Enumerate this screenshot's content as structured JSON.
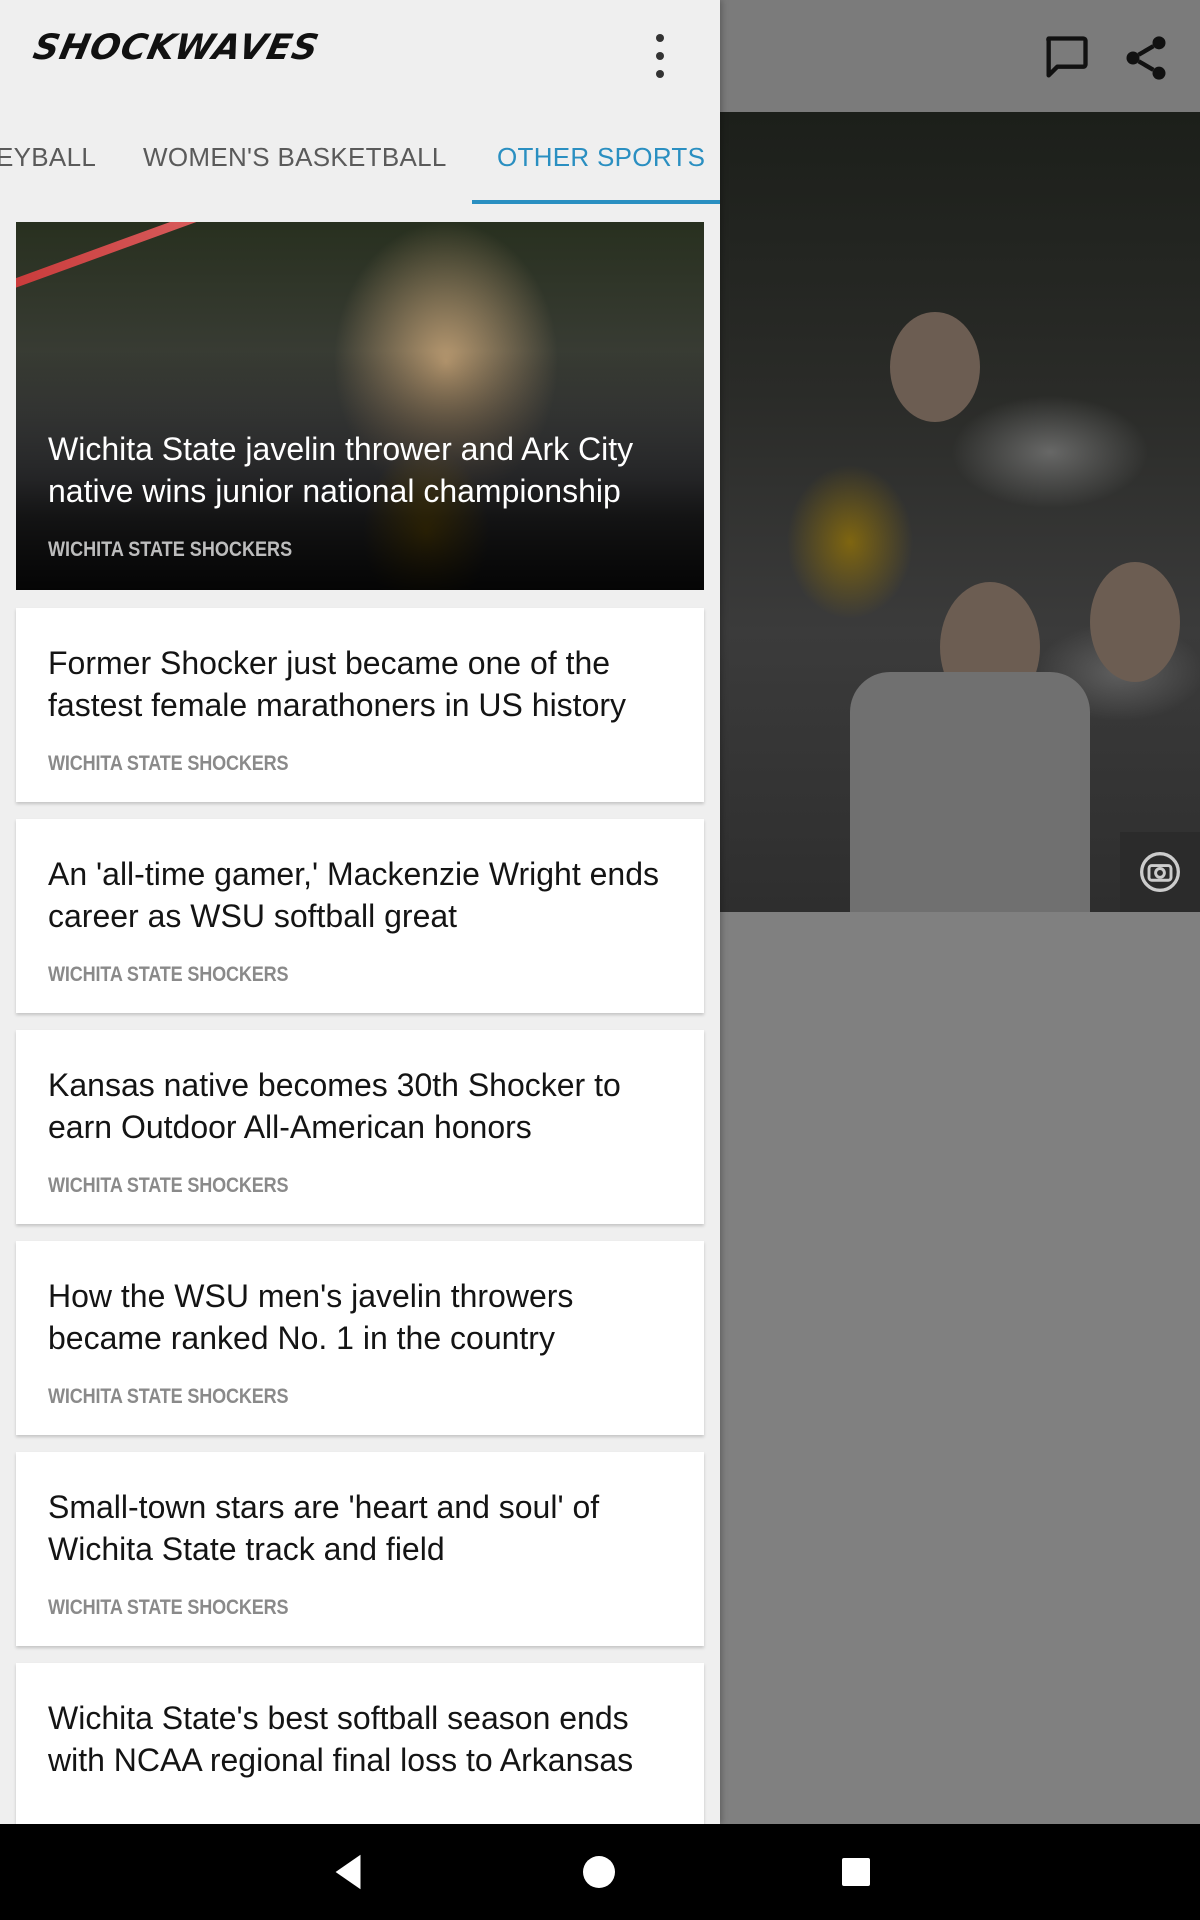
{
  "app": {
    "logo_text": "SHOCKWAVES",
    "accent_color": "#2a8fc1"
  },
  "toolbar_right": {
    "icons": [
      "comment-icon",
      "share-icon"
    ]
  },
  "tabs": [
    {
      "label": "EYBALL",
      "active": false
    },
    {
      "label": "WOMEN'S BASKETBALL",
      "active": false
    },
    {
      "label": "OTHER SPORTS",
      "active": true
    }
  ],
  "articles": [
    {
      "headline": "Wichita State javelin thrower and Ark City native wins junior national championship",
      "source": "WICHITA STATE SHOCKERS",
      "has_image": true
    },
    {
      "headline": "Former Shocker just became one of the fastest female marathoners in US history",
      "source": "WICHITA STATE SHOCKERS"
    },
    {
      "headline": "An 'all-time gamer,' Mackenzie Wright ends career as WSU softball great",
      "source": "WICHITA STATE SHOCKERS"
    },
    {
      "headline": "Kansas native becomes 30th Shocker to earn Outdoor All-American honors",
      "source": "WICHITA STATE SHOCKERS"
    },
    {
      "headline": "How the WSU men's javelin throwers became ranked No. 1 in the country",
      "source": "WICHITA STATE SHOCKERS"
    },
    {
      "headline": "Small-town stars are 'heart and soul' of Wichita State track and field",
      "source": "WICHITA STATE SHOCKERS"
    },
    {
      "headline": "Wichita State's best softball season ends with NCAA regional final loss to Arkansas",
      "source": ""
    }
  ],
  "navbar": {
    "icons": [
      "back-icon",
      "home-icon",
      "recents-icon"
    ]
  }
}
